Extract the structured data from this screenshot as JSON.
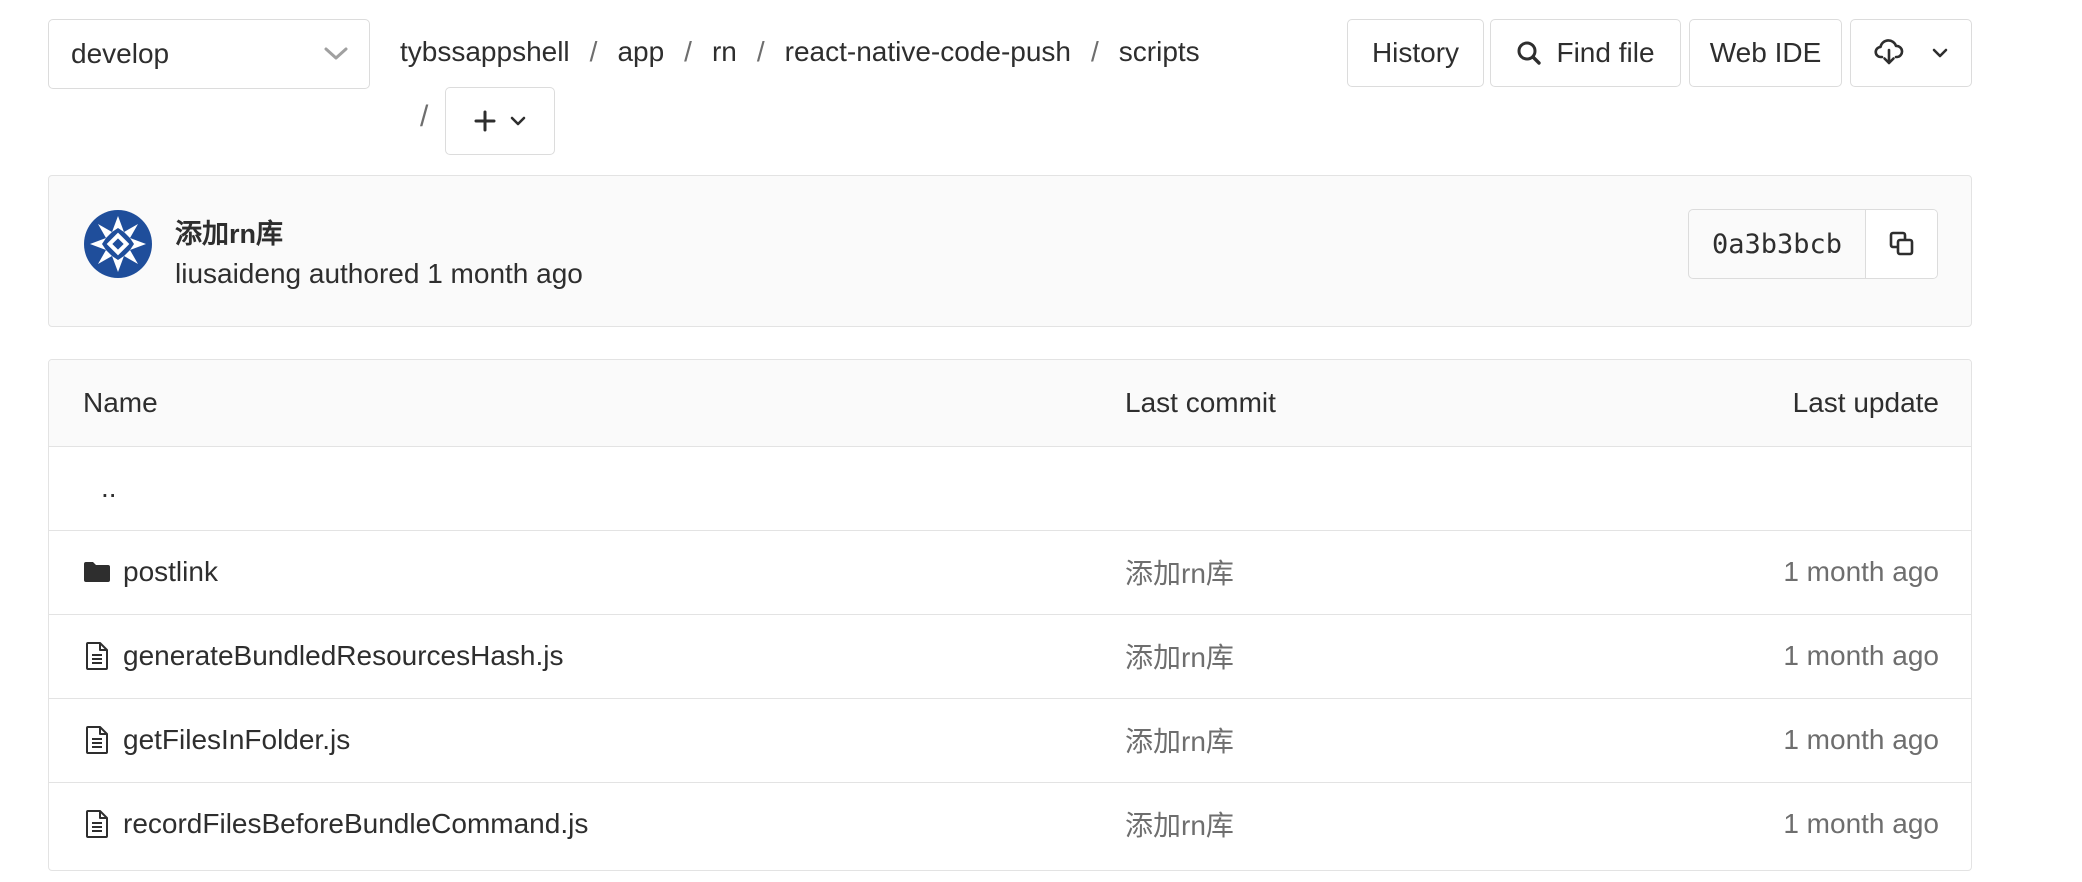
{
  "branch": {
    "selected": "develop",
    "icon": "chevron-down-icon"
  },
  "breadcrumb": {
    "items": [
      "tybssappshell",
      "app",
      "rn",
      "react-native-code-push",
      "scripts"
    ],
    "separator": "/"
  },
  "toolbar": {
    "history_label": "History",
    "find_file_label": "Find file",
    "web_ide_label": "Web IDE",
    "add_icon": "plus-icon",
    "download_icon": "cloud-download-icon"
  },
  "commit": {
    "title": "添加rn库",
    "meta": "liusaideng authored 1 month ago",
    "sha": "0a3b3bcb",
    "avatar_color": "#1f4e9b"
  },
  "table": {
    "headers": {
      "name": "Name",
      "last_commit": "Last commit",
      "last_update": "Last update"
    },
    "parent": "..",
    "rows": [
      {
        "name": "postlink",
        "type": "folder",
        "icon": "folder-icon",
        "commit": "添加rn库",
        "updated": "1 month ago"
      },
      {
        "name": "generateBundledResourcesHash.js",
        "type": "file",
        "icon": "file-icon",
        "commit": "添加rn库",
        "updated": "1 month ago"
      },
      {
        "name": "getFilesInFolder.js",
        "type": "file",
        "icon": "file-icon",
        "commit": "添加rn库",
        "updated": "1 month ago"
      },
      {
        "name": "recordFilesBeforeBundleCommand.js",
        "type": "file",
        "icon": "file-icon",
        "commit": "添加rn库",
        "updated": "1 month ago"
      }
    ]
  }
}
